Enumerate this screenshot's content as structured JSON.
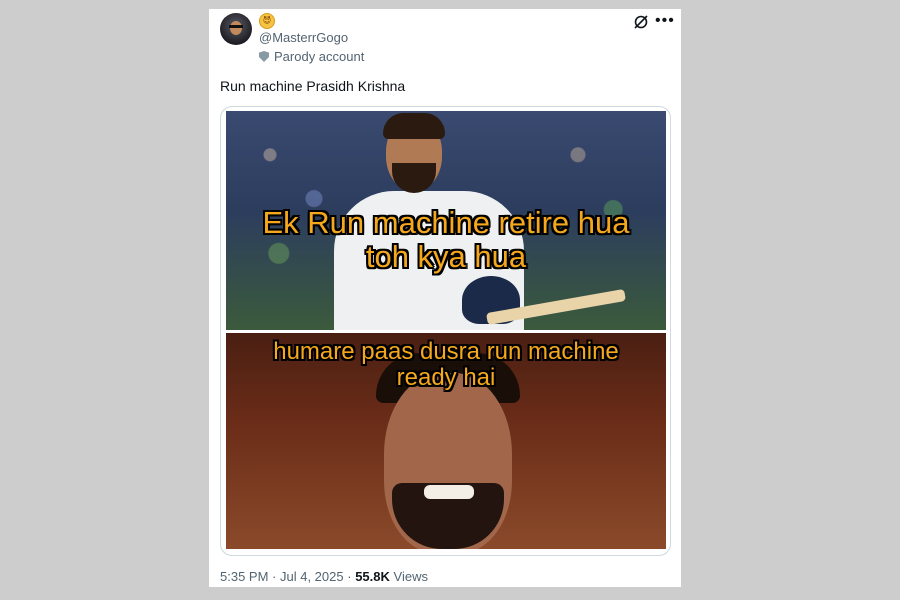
{
  "post": {
    "emoji_badge": "😈",
    "handle": "@MasterrGogo",
    "account_label": "Parody account",
    "text": "Run machine Prasidh Krishna",
    "meme": {
      "top_line1": "Ek Run machine retire hua",
      "top_line2": "toh kya hua",
      "bottom_line1": "humare paas dusra run machine",
      "bottom_line2": "ready hai"
    },
    "time": "5:35 PM",
    "date": "Jul 4, 2025",
    "views_count": "55.8K",
    "views_label": "Views"
  },
  "icons": {
    "grok": "grok-icon",
    "more": "more-options-icon",
    "parody": "parody-shield-icon"
  },
  "colors": {
    "meme_text": "#f5a81c",
    "secondary_text": "#536471",
    "primary_text": "#0f1419"
  }
}
